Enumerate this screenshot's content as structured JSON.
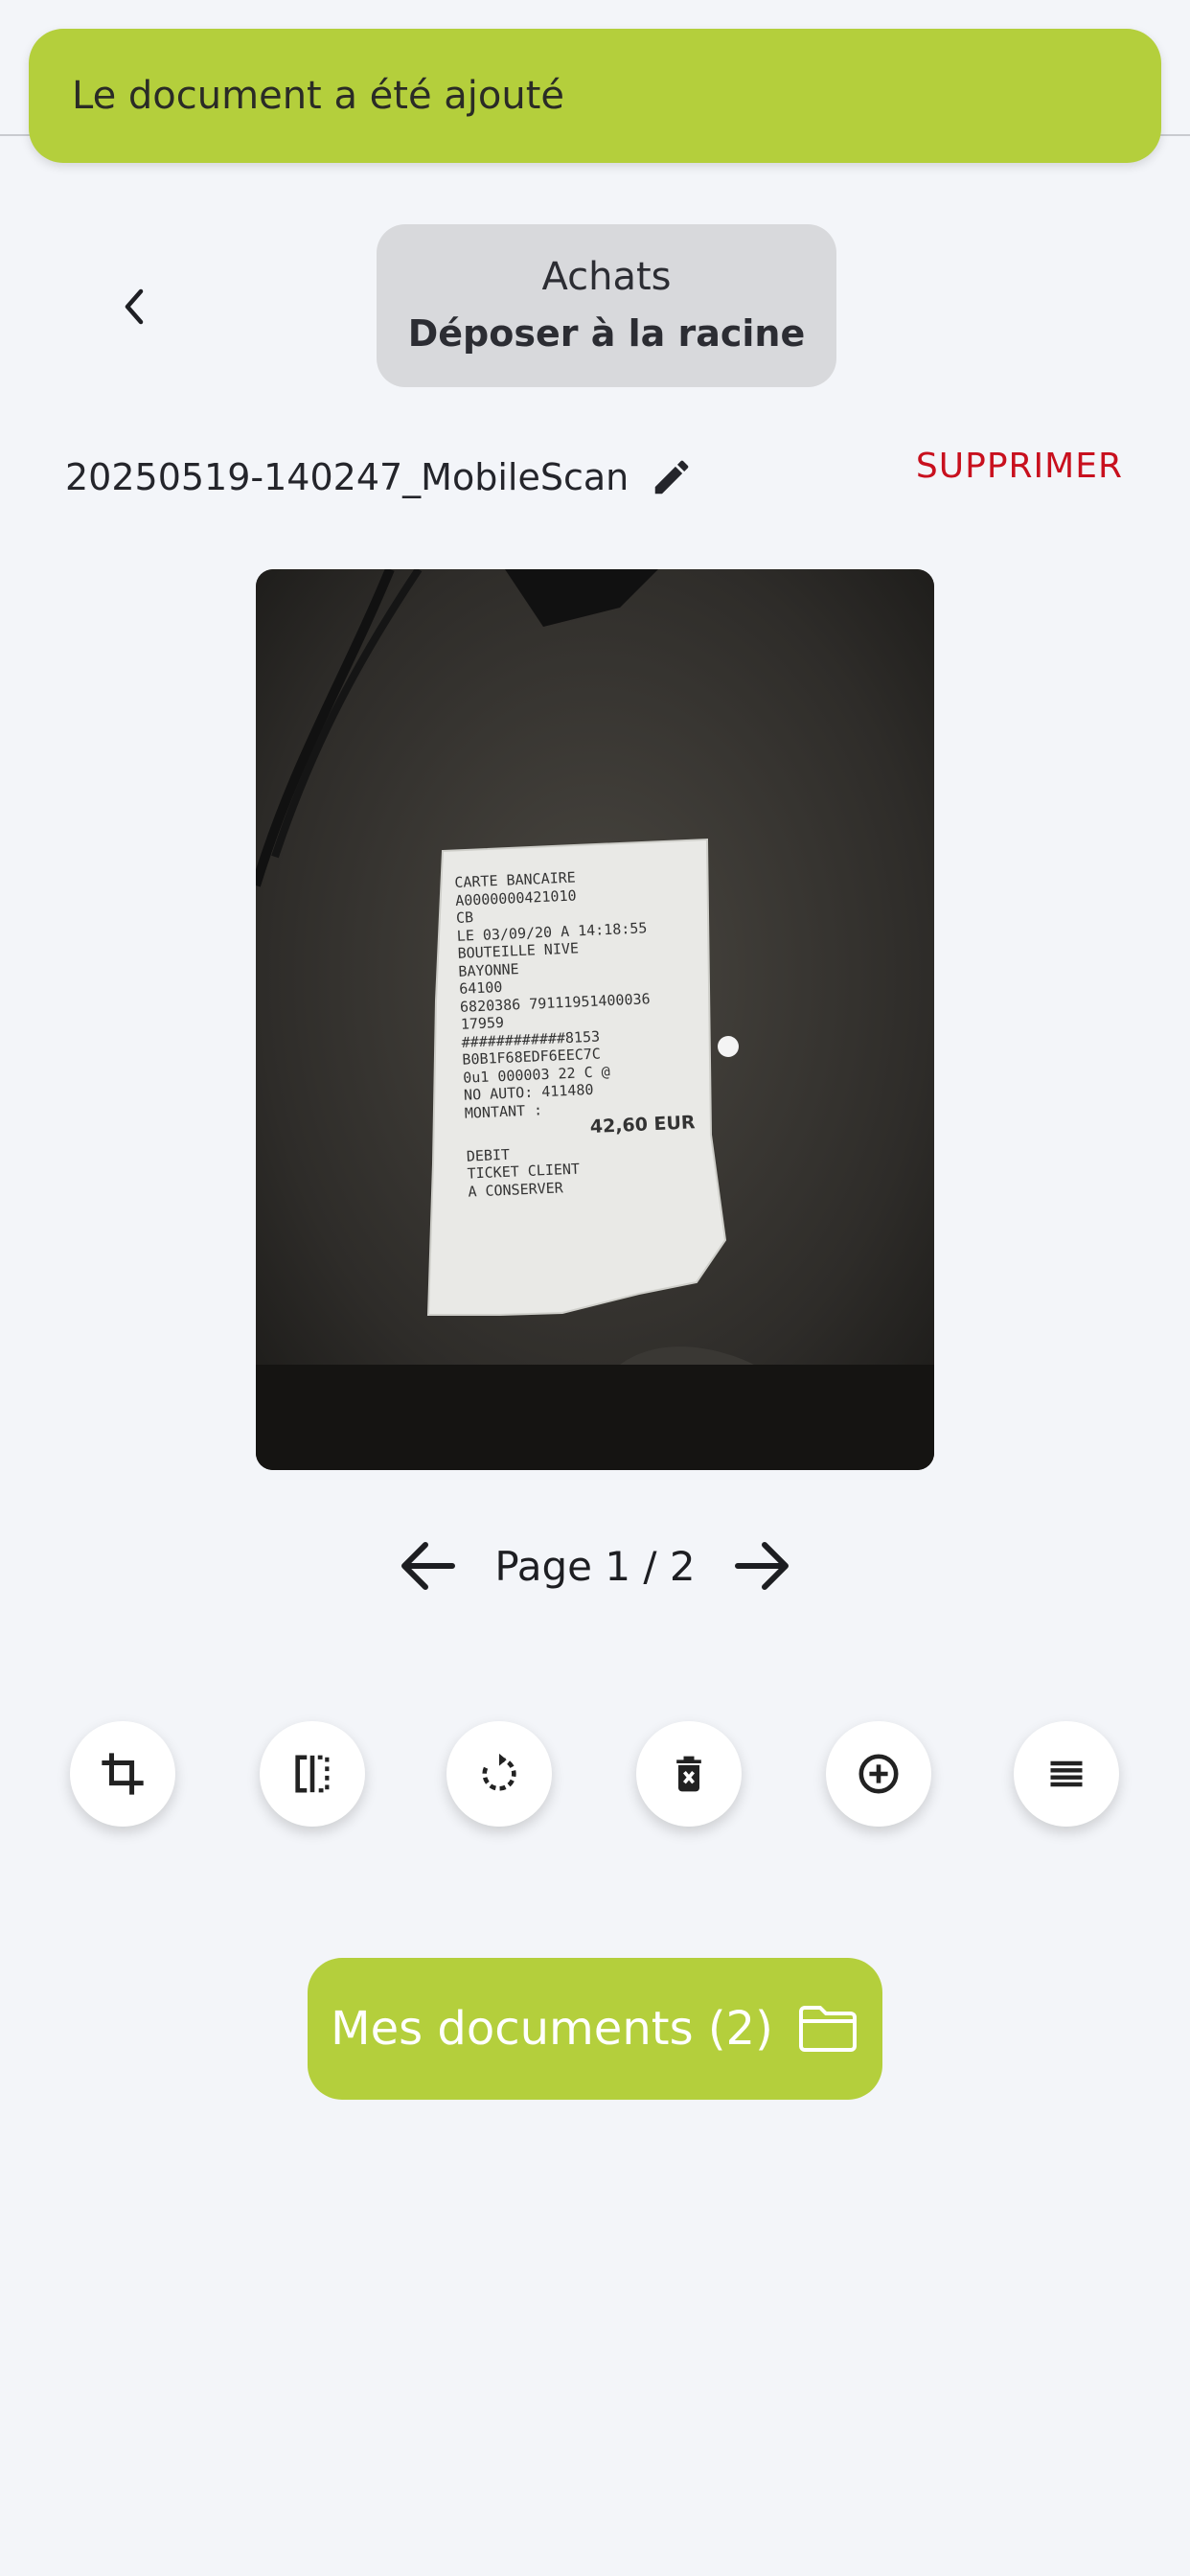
{
  "toast": {
    "message": "Le document a été ajouté"
  },
  "folder": {
    "name": "Achats",
    "action": "Déposer à la racine"
  },
  "file": {
    "name": "20250519-140247_MobileScan",
    "delete_label": "SUPPRIMER"
  },
  "receipt": {
    "lines": [
      "CARTE BANCAIRE",
      "A0000000421010",
      "CB",
      "LE 03/09/20 A 14:18:55",
      "BOUTEILLE NIVE",
      "BAYONNE",
      "64100",
      "6820386 79111951400036",
      "17959",
      "############8153",
      "B0B1F68EDF6EEC7C",
      "0u1 000003 22 C @",
      "NO AUTO: 411480",
      "MONTANT :"
    ],
    "amount": "42,60 EUR",
    "footer": [
      "DEBIT",
      "TICKET CLIENT",
      "A CONSERVER"
    ]
  },
  "pager": {
    "label": "Page 1 / 2"
  },
  "tools": [
    {
      "icon": "crop-icon"
    },
    {
      "icon": "split-icon"
    },
    {
      "icon": "rotate-icon"
    },
    {
      "icon": "delete-page-icon"
    },
    {
      "icon": "add-page-icon"
    },
    {
      "icon": "reorder-icon"
    }
  ],
  "docs_button": {
    "label": "Mes documents (2)"
  },
  "colors": {
    "accent": "#b4cf3c",
    "danger": "#c8101e",
    "background": "#f3f5f9"
  }
}
